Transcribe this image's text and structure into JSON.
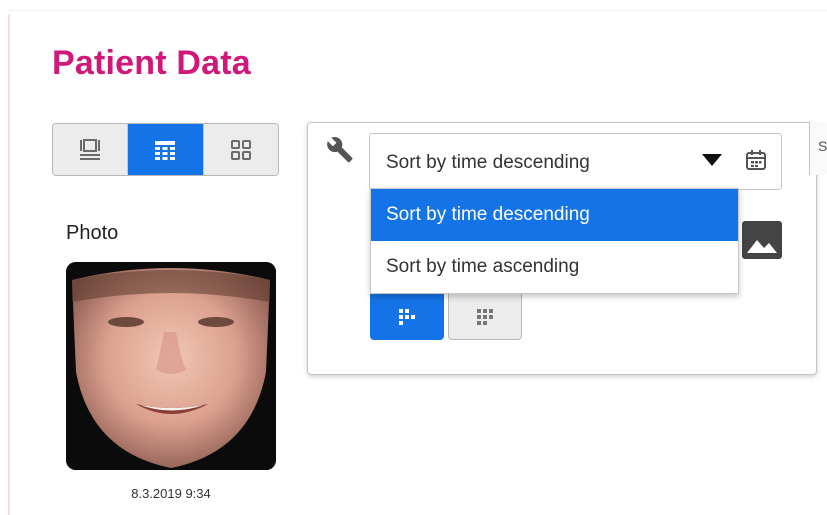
{
  "page": {
    "title": "Patient Data"
  },
  "view_toggle": {
    "buttons": [
      {
        "icon": "single-view-icon",
        "active": false
      },
      {
        "icon": "list-view-icon",
        "active": true
      },
      {
        "icon": "grid-view-icon",
        "active": false
      }
    ]
  },
  "photo": {
    "label": "Photo",
    "date": "8.3.2019 9:34"
  },
  "settings": {
    "sort": {
      "selected": "Sort by time descending",
      "options": [
        "Sort by time descending",
        "Sort by time ascending"
      ]
    },
    "edge_text": "S"
  },
  "colors": {
    "accent": "#1473e6",
    "title": "#d0177a"
  }
}
